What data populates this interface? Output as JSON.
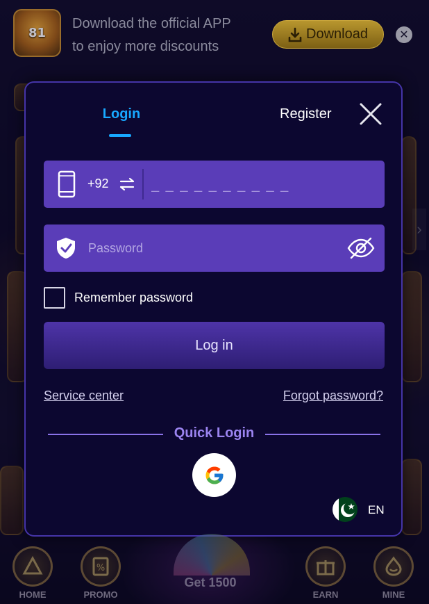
{
  "banner": {
    "logo_text": "81",
    "line1": "Download the official APP",
    "line2": "to enjoy more discounts",
    "download_label": "Download",
    "close_icon": "close-icon"
  },
  "modal": {
    "tabs": [
      {
        "label": "Login",
        "active": true
      },
      {
        "label": "Register",
        "active": false
      }
    ],
    "phone": {
      "country_code": "+92",
      "placeholder": "_ _ _ _ _ _ _ _ _ _"
    },
    "password": {
      "placeholder": "Password"
    },
    "remember_label": "Remember password",
    "login_button": "Log in",
    "service_link": "Service center",
    "forgot_link": "Forgot password?",
    "quick_login_title": "Quick Login",
    "language": "EN"
  },
  "bottom_nav": {
    "items": [
      {
        "label": "HOME"
      },
      {
        "label": "PROMO"
      },
      {
        "label": "EARN"
      },
      {
        "label": "MINE"
      }
    ],
    "center_label": "Get 1500"
  },
  "colors": {
    "accent": "#18a8ff",
    "field_bg": "#5a3db8",
    "modal_bg": "#0c0730",
    "quick_login": "#9b84f0"
  }
}
